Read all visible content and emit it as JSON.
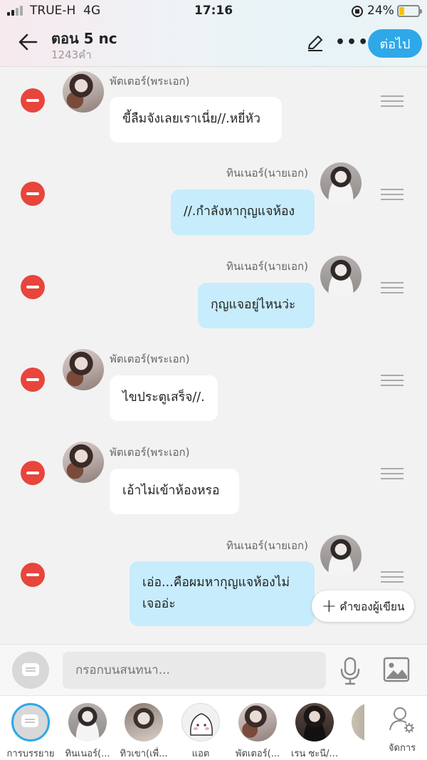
{
  "status_bar": {
    "carrier": "TRUE-H",
    "network": "4G",
    "time": "17:16",
    "battery": "24%"
  },
  "header": {
    "title": "ตอน 5 nc",
    "subtitle": "1243คำ",
    "next_label": "ต่อไป"
  },
  "messages": [
    {
      "speaker": "พัตเตอร์(พระเอก)",
      "text": "ขี้ลืมจังเลยเราเนี่ย//.หยี่หัว",
      "side": "left"
    },
    {
      "speaker": "ทินเนอร์(นายเอก)",
      "text": "//.กำลังหากุญแจห้อง",
      "side": "right"
    },
    {
      "speaker": "ทินเนอร์(นายเอก)",
      "text": "กุญแจอยู่ไหนว่ะ",
      "side": "right"
    },
    {
      "speaker": "พัตเตอร์(พระเอก)",
      "text": "ไขประตูเสร็จ//.",
      "side": "left"
    },
    {
      "speaker": "พัตเตอร์(พระเอก)",
      "text": "เอ้าไม่เข้าห้องหรอ",
      "side": "left"
    },
    {
      "speaker": "ทินเนอร์(นายเอก)",
      "text_line1": "เอ่อ...คือผมหากุญแจห้องไม่",
      "text_line2": "เจออ่ะ",
      "side": "right"
    }
  ],
  "add_writer_label": "คำของผู้เขียน",
  "input": {
    "placeholder": "กรอกบนสนทนา..."
  },
  "cast": [
    {
      "name": "การบรรยาย"
    },
    {
      "name": "ทินเนอร์(..."
    },
    {
      "name": "ทิวเขา(เพื่..."
    },
    {
      "name": "แอต"
    },
    {
      "name": "พัตเตอร์(..."
    },
    {
      "name": "เรน ซะนี/..."
    }
  ],
  "manage_label": "จัดการ",
  "colors": {
    "accent": "#2ea8e8",
    "delete": "#e8453c",
    "bubble_right": "#c7ecfb",
    "bubble_left": "#ffffff"
  }
}
